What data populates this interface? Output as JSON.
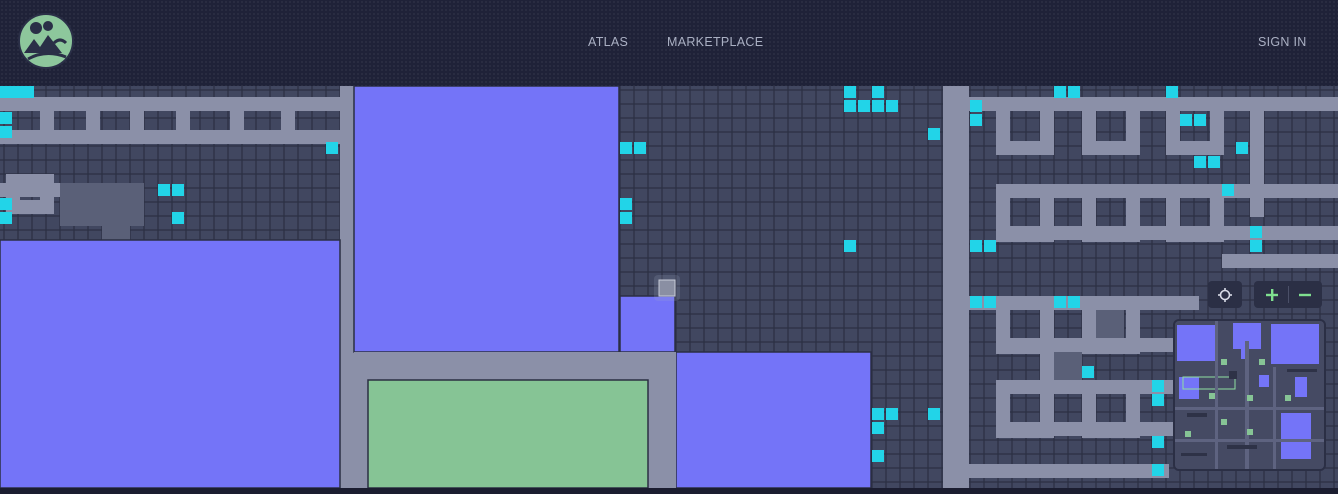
{
  "header": {
    "logo_icon": "globe-landscape-logo-icon",
    "nav": [
      {
        "label": "ATLAS"
      },
      {
        "label": "MARKETPLACE"
      }
    ],
    "sign_in_label": "SIGN IN"
  },
  "map": {
    "legend_colors": {
      "parcel": "#414760",
      "parcel_border": "#2b2f42",
      "road": "#8b90a8",
      "estate": "#7474f8",
      "plaza": "#86c495",
      "highlight": "#22d4e8",
      "owned": "#5a6078",
      "selected": "#8a8fa3"
    }
  },
  "controls": {
    "locate_icon": "crosshair-icon",
    "zoom_in_icon": "plus-icon",
    "zoom_out_icon": "minus-icon"
  },
  "minimap": {
    "icon": "minimap-overview"
  }
}
